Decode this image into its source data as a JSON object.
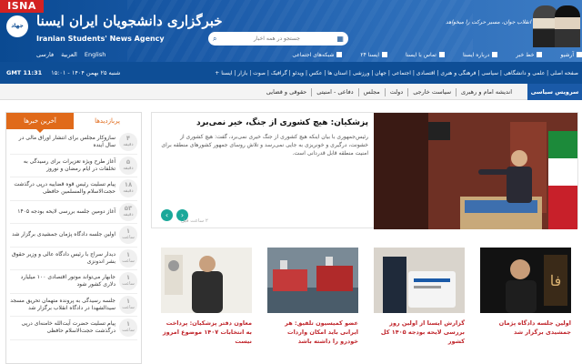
{
  "header": {
    "badge": "ISNA",
    "logo_text": "جهاد",
    "agency_fa": "خبرگزاری دانشجویان ایران ایسنا",
    "agency_en": "Iranian Students' News Agency",
    "search_placeholder": "جستجو در همه اخبار",
    "quote": "انقلاب جوان، مسیر حرکت را میخواهد",
    "languages": [
      "فارسی",
      "العربیة",
      "English"
    ],
    "quick_links": [
      "شبکه‌های اجتماعی",
      "ایسنا ۲۴",
      "تماس با ایسنا",
      "درباره ایسنا",
      "خط خبر",
      "آرشیو"
    ]
  },
  "mainnav": {
    "time": "GMT 11:31",
    "date": "شنبه ۲۵ بهمن ۱۴۰۴ - ۱۵:۰۱",
    "menu": "صفحه اصلی | علمی و دانشگاهی | سیاسی | فرهنگی و هنری | اقتصادی | اجتماعی | جهان | ورزشی | استان ها | عکس | ویدئو | گرافیک | صوت | بازار | ایسنا +"
  },
  "subnav": {
    "service": "سرویس سیاسی",
    "items": [
      "اندیشه امام و رهبری",
      "سیاست خارجی",
      "دولت",
      "مجلس",
      "دفاعی - امنیتی",
      "حقوقی و قضایی"
    ]
  },
  "sidebar": {
    "tabs": [
      "آخرین خبرها",
      "پربازدیدها"
    ],
    "items": [
      {
        "ago": "۴",
        "unit": "دقیقه",
        "title": "سازوکار مجلس برای انتشار اوراق مالی در سال آینده"
      },
      {
        "ago": "۵",
        "unit": "دقیقه",
        "title": "آغاز طرح ویژه تعزیرات برای رسیدگی به تخلفات در ایام رمضان و نوروز"
      },
      {
        "ago": "۱۸",
        "unit": "دقیقه",
        "title": "پیام تسلیت رئیس قوه قضاییه درپی درگذشت حجت‌الاسلام والمسلمین حافظی"
      },
      {
        "ago": "۵۳",
        "unit": "دقیقه",
        "title": "آغاز دومین جلسه بررسی لایحه بودجه ۱۴۰۵"
      },
      {
        "ago": "۱",
        "unit": "ساعت",
        "title": "اولین جلسه دادگاه پژمان جمشیدی برگزار شد"
      },
      {
        "ago": "۱",
        "unit": "ساعت",
        "title": "دیدار سراج با رئیس دادگاه عالی و وزیر حقوق بشر اندونزی"
      },
      {
        "ago": "۱",
        "unit": "ساعت",
        "title": "جابهار می‌تواند موتور اقتصادی ۱۰۰ میلیارد دلاری کشور شود"
      },
      {
        "ago": "۱",
        "unit": "ساعت",
        "title": "جلسه رسیدگی به پرونده متهمان تحریق مسجد سیدالشهدا در دادگاه انقلاب برگزار شد"
      },
      {
        "ago": "۱",
        "unit": "ساعت",
        "title": "پیام تسلیت حضرت آیت‌الله خامنه‌ای درپی درگذشت حجت‌الاسلام حافظی"
      }
    ]
  },
  "featured": {
    "title": "پزشکیان: هیچ کشوری از جنگ، خیر نمی‌برد",
    "summary": "رئیس‌جمهوری با بیان اینکه هیچ کشوری از جنگ خیری نمی‌برد، گفت: هیچ کشوری از خشونت، درگیری و خونریزی به جایی نمی‌رسد و تلاش روسای جمهور کشورهای منطقه برای امنیت منطقه قابل قدردانی است.",
    "ago": "۲ ساعت قبل",
    "prev": "‹",
    "next": "›"
  },
  "cards": [
    {
      "title": "اولین جلسه دادگاه پژمان جمشیدی برگزار شد"
    },
    {
      "title": "گزارش ایسنا از اولین روز بررسی لایحه بودجه ۱۴۰۵ کل کشور"
    },
    {
      "title": "عضو کمیسیون تلفیق: هر ایرانی باید امکان واردات خودرو را داشته باشد"
    },
    {
      "title": "معاون دفتر پزشکیان: پرداخت به انتخابات ۱۴۰۷ موضوع امروز نیست"
    }
  ]
}
